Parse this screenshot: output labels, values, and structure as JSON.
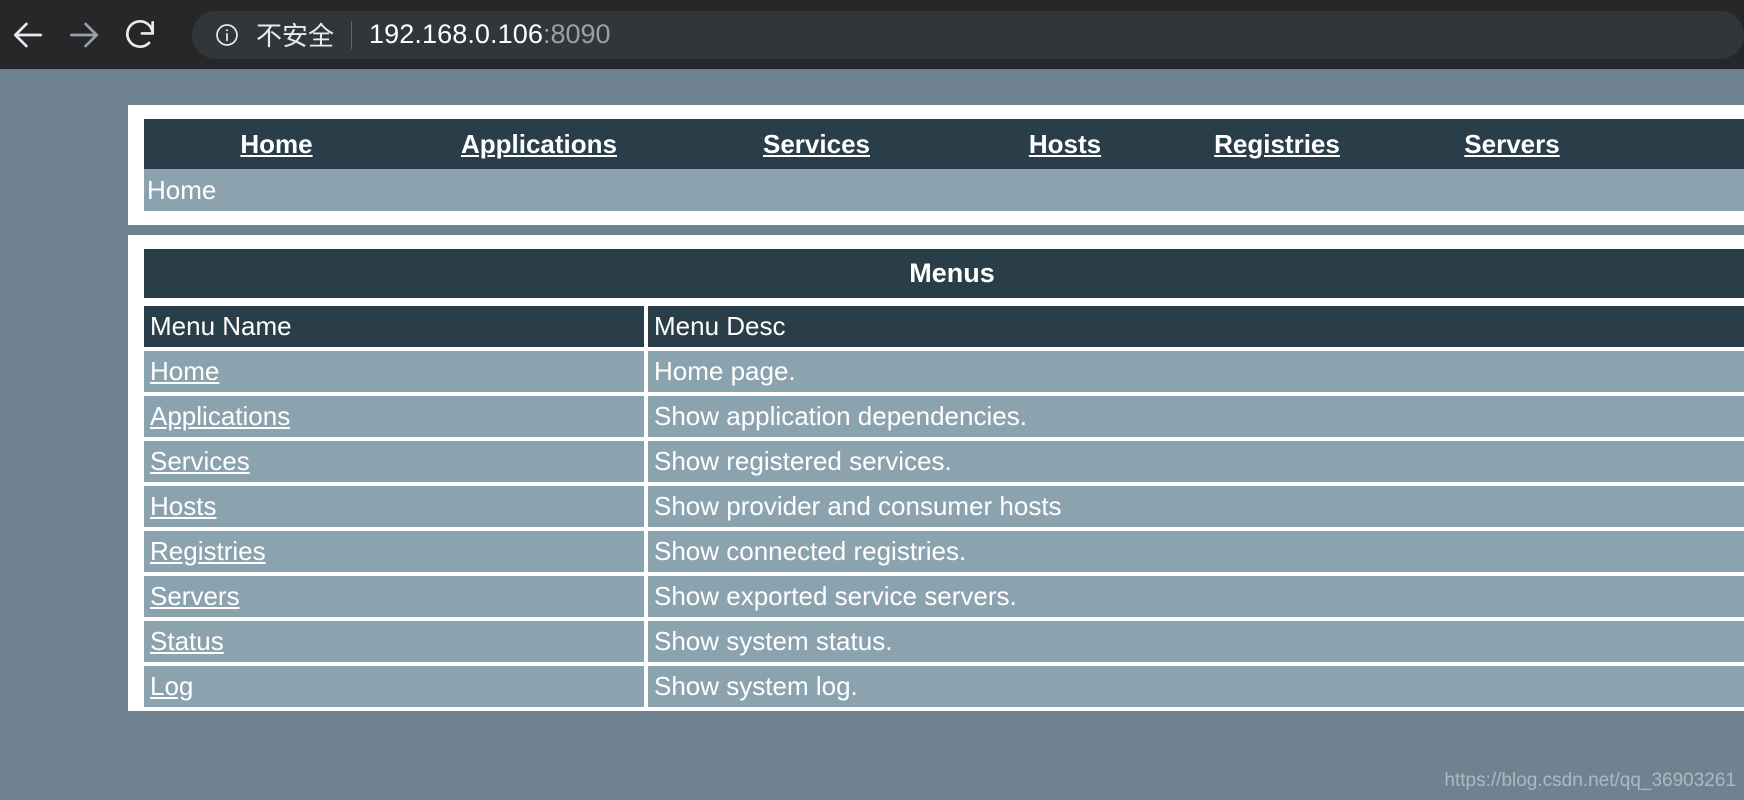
{
  "browser": {
    "back_icon": "arrow-left-icon",
    "forward_icon": "arrow-right-icon",
    "reload_icon": "reload-icon",
    "info_icon": "info-circle-icon",
    "security_label": "不安全",
    "url_host": "192.168.0.106",
    "url_rest": ":8090"
  },
  "nav": {
    "items": [
      {
        "label": "Home"
      },
      {
        "label": "Applications"
      },
      {
        "label": "Services"
      },
      {
        "label": "Hosts"
      },
      {
        "label": "Registries"
      },
      {
        "label": "Servers"
      }
    ]
  },
  "breadcrumb": {
    "current": "Home"
  },
  "menus_panel": {
    "title": "Menus",
    "columns": [
      "Menu Name",
      "Menu Desc"
    ],
    "rows": [
      {
        "name": "Home",
        "desc": "Home page."
      },
      {
        "name": "Applications",
        "desc": "Show application dependencies."
      },
      {
        "name": "Services",
        "desc": "Show registered services."
      },
      {
        "name": "Hosts",
        "desc": "Show provider and consumer hosts"
      },
      {
        "name": "Registries",
        "desc": "Show connected registries."
      },
      {
        "name": "Servers",
        "desc": "Show exported service servers."
      },
      {
        "name": "Status",
        "desc": "Show system status."
      },
      {
        "name": "Log",
        "desc": "Show system log."
      }
    ]
  },
  "watermark": {
    "text": "https://blog.csdn.net/qq_36903261"
  },
  "colors": {
    "chrome_bg": "#252729",
    "omnibox_bg": "#323639",
    "page_bg": "#6e838f",
    "header_dark": "#293e48",
    "row_light": "#8ba3af",
    "panel_white": "#ffffff"
  }
}
